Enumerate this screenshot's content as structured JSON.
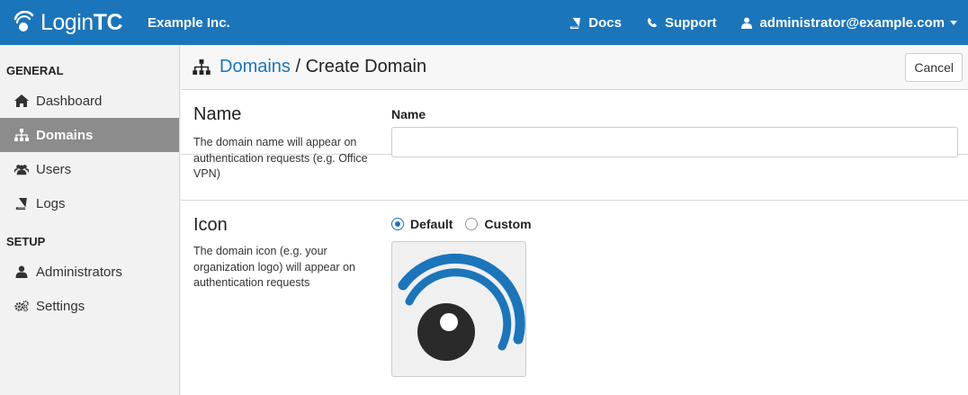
{
  "brand": {
    "prefix": "Login",
    "suffix": "TC"
  },
  "org_name": "Example Inc.",
  "topnav": {
    "docs": "Docs",
    "support": "Support",
    "user": "administrator@example.com"
  },
  "sidebar": {
    "general_label": "GENERAL",
    "setup_label": "SETUP",
    "general_items": [
      {
        "label": "Dashboard",
        "icon": "home-icon"
      },
      {
        "label": "Domains",
        "icon": "sitemap-icon",
        "active": true
      },
      {
        "label": "Users",
        "icon": "users-icon"
      },
      {
        "label": "Logs",
        "icon": "book-icon"
      }
    ],
    "setup_items": [
      {
        "label": "Administrators",
        "icon": "user-icon"
      },
      {
        "label": "Settings",
        "icon": "gears-icon"
      }
    ]
  },
  "header": {
    "crumb_link": "Domains",
    "crumb_sep": " / ",
    "crumb_current": "Create Domain",
    "cancel": "Cancel"
  },
  "form": {
    "name": {
      "title": "Name",
      "description": "The domain name will appear on authentication requests (e.g. Office VPN)",
      "field_label": "Name",
      "value": "",
      "placeholder": ""
    },
    "icon": {
      "title": "Icon",
      "description": "The domain icon (e.g. your organization logo) will appear on authentication requests",
      "options": [
        "Default",
        "Custom"
      ],
      "selected": "Default"
    }
  },
  "colors": {
    "primary": "#1b75bb",
    "active_nav": "#8c8c8c"
  }
}
